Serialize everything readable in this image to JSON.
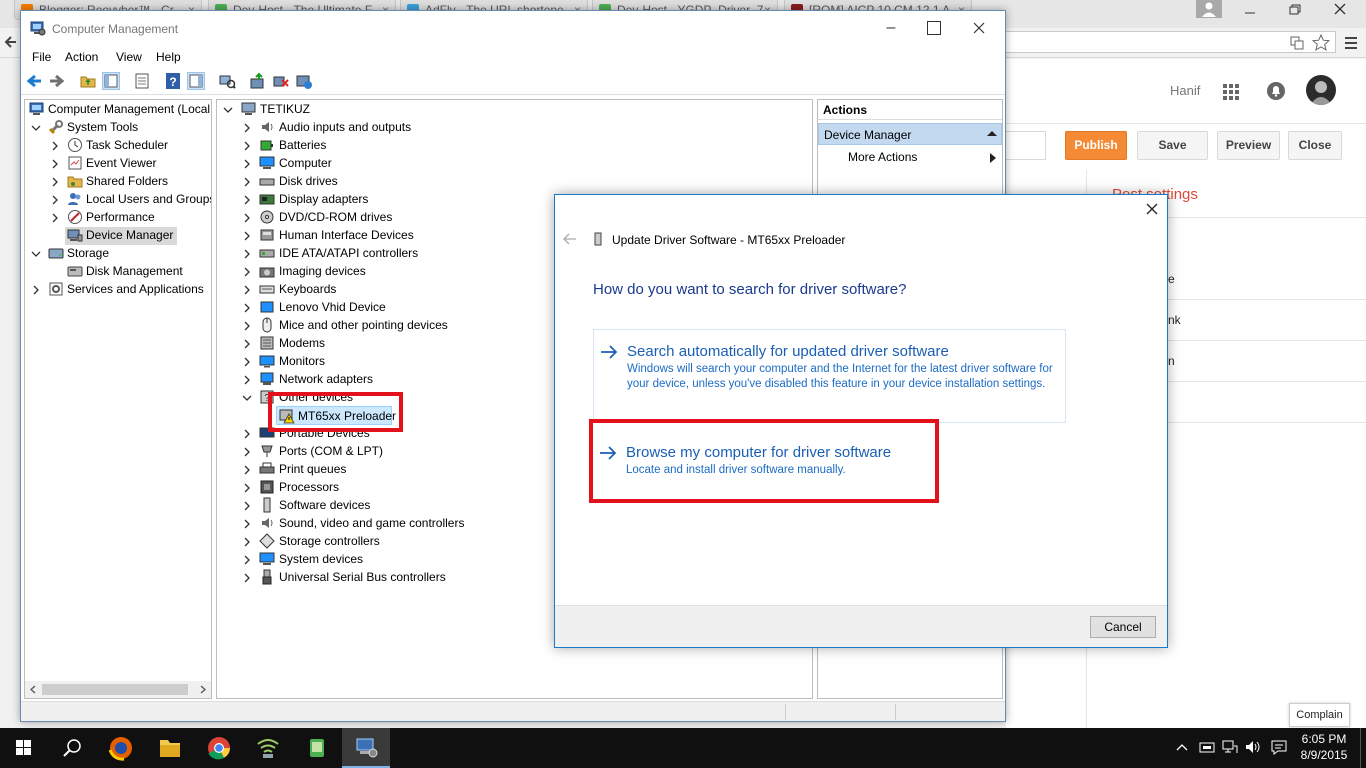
{
  "chrome": {
    "tabs": [
      {
        "label": "Blogger: Reeyvber™ - Cr",
        "color": "#f57d00"
      },
      {
        "label": "Dev-Host - The Ultimate F",
        "color": "#4caf50"
      },
      {
        "label": "AdFly - The URL shortene",
        "color": "#3aa0d8"
      },
      {
        "label": "Dev-Host - YGDP_Driver_7",
        "color": "#4caf50"
      },
      {
        "label": "[ROM] AICP 10 CM 12.1 A",
        "color": "#8a1c1c"
      }
    ],
    "tab_close": "×"
  },
  "blogger": {
    "user": "Hanif",
    "buttons": {
      "publish": "Publish",
      "save": "Save",
      "preview": "Preview",
      "close": "Close"
    },
    "post_settings": "Post settings",
    "side_fragments": [
      "e",
      "nk",
      "n"
    ],
    "complain": "Complain",
    "accent": "#f48a33"
  },
  "cm": {
    "title": "Computer Management",
    "menu": [
      "File",
      "Action",
      "View",
      "Help"
    ],
    "left_tree": {
      "root": "Computer Management (Local",
      "system_tools": "System Tools",
      "items": [
        "Task Scheduler",
        "Event Viewer",
        "Shared Folders",
        "Local Users and Groups",
        "Performance",
        "Device Manager"
      ],
      "storage": "Storage",
      "disk_mgmt": "Disk Management",
      "services": "Services and Applications"
    },
    "devices": {
      "root": "TETIKUZ",
      "categories": [
        "Audio inputs and outputs",
        "Batteries",
        "Computer",
        "Disk drives",
        "Display adapters",
        "DVD/CD-ROM drives",
        "Human Interface Devices",
        "IDE ATA/ATAPI controllers",
        "Imaging devices",
        "Keyboards",
        "Lenovo Vhid Device",
        "Mice and other pointing devices",
        "Modems",
        "Monitors",
        "Network adapters",
        "Other devices"
      ],
      "child": "MT65xx Preloader",
      "more": [
        "Portable Devices",
        "Ports (COM & LPT)",
        "Print queues",
        "Processors",
        "Software devices",
        "Sound, video and game controllers",
        "Storage controllers",
        "System devices",
        "Universal Serial Bus controllers"
      ]
    },
    "actions": {
      "header": "Actions",
      "group": "Device Manager",
      "more": "More Actions"
    }
  },
  "dialog": {
    "title": "Update Driver Software - MT65xx Preloader",
    "question": "How do you want to search for driver software?",
    "option1_title": "Search automatically for updated driver software",
    "option1_desc": "Windows will search your computer and the Internet for the latest driver software for your device, unless you've disabled this feature in your device installation settings.",
    "option2_title": "Browse my computer for driver software",
    "option2_desc": "Locate and install driver software manually.",
    "cancel": "Cancel"
  },
  "taskbar": {
    "time": "6:05 PM",
    "date": "8/9/2015"
  },
  "colors": {
    "highlight": "#e3111b",
    "link": "#1a5fb4",
    "dialog_border": "#1979ca"
  }
}
